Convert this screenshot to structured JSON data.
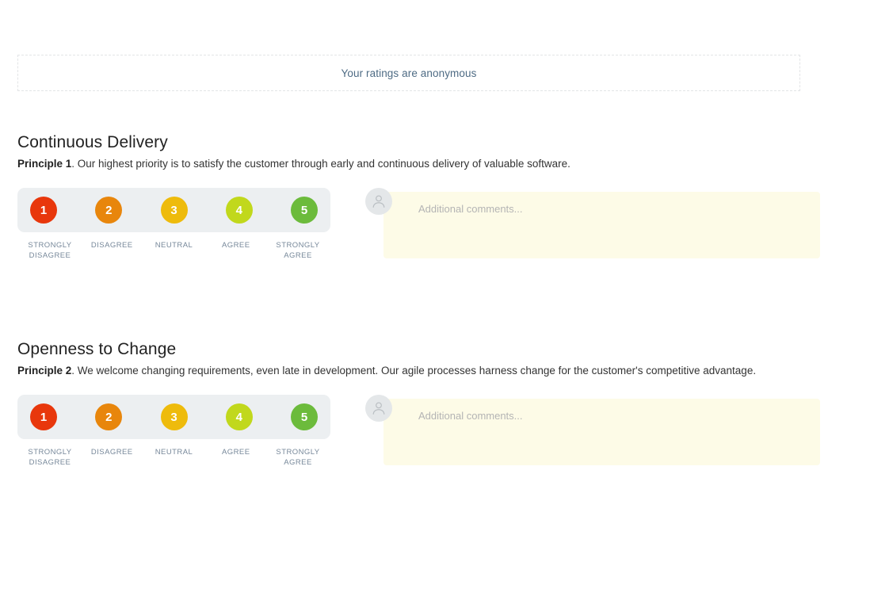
{
  "banner": {
    "text": "Your ratings are anonymous",
    "text_color": "#4e6b84"
  },
  "scale": {
    "options": [
      {
        "value": "1",
        "label": "STRONGLY DISAGREE",
        "color": "#e8370c"
      },
      {
        "value": "2",
        "label": "DISAGREE",
        "color": "#e8860c"
      },
      {
        "value": "3",
        "label": "NEUTRAL",
        "color": "#eebb0c"
      },
      {
        "value": "4",
        "label": "AGREE",
        "color": "#c1d81c"
      },
      {
        "value": "5",
        "label": "STRONGLY AGREE",
        "color": "#6cbb3c"
      }
    ],
    "track_color": "#eceff1",
    "label_color": "#77889a"
  },
  "comment": {
    "placeholder": "Additional comments...",
    "value": "",
    "background": "#fdfbe7",
    "avatar_icon": "person-avatar-icon"
  },
  "questions": [
    {
      "title": "Continuous Delivery",
      "principle_label": "Principle 1",
      "principle_text": ". Our highest priority is to satisfy the customer through early and continuous delivery of valuable software."
    },
    {
      "title": "Openness to Change",
      "principle_label": "Principle 2",
      "principle_text": ". We welcome changing requirements, even late in development. Our agile processes harness change for the customer's competitive advantage."
    }
  ]
}
